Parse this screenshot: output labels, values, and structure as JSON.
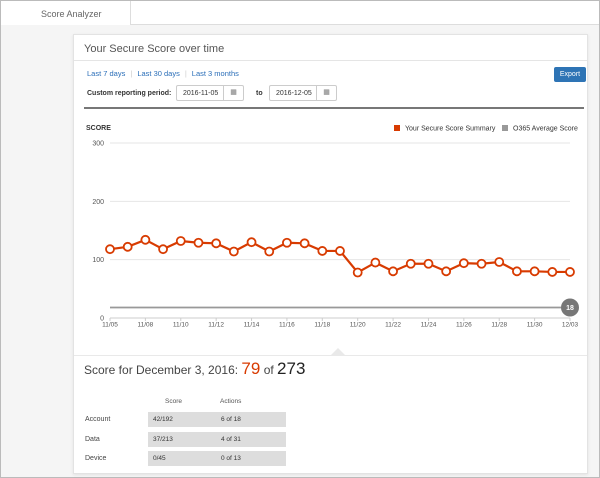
{
  "tab": {
    "label": "Score Analyzer"
  },
  "panel": {
    "title": "Your Secure Score over time",
    "range_links": [
      "Last 7 days",
      "Last 30 days",
      "Last 3 months"
    ],
    "export_label": "Export",
    "period_label": "Custom reporting period:",
    "start_date": "2016-11-05",
    "to_label": "to",
    "end_date": "2016-12-05",
    "calendar_icon": "calendar-icon"
  },
  "chart_data": {
    "type": "line",
    "ylabel": "SCORE",
    "ylim": [
      0,
      300
    ],
    "yticks": [
      0,
      100,
      200,
      300
    ],
    "x_tick_labels": [
      "11/05",
      "11/08",
      "11/10",
      "11/12",
      "11/14",
      "11/16",
      "11/18",
      "11/20",
      "11/22",
      "11/24",
      "11/26",
      "11/28",
      "11/30",
      "12/03"
    ],
    "grid": true,
    "legend_position": "top-right",
    "series": [
      {
        "name": "Your Secure Score Summary",
        "color": "#d83b01",
        "values": [
          118,
          122,
          134,
          118,
          132,
          129,
          128,
          114,
          130,
          114,
          129,
          128,
          115,
          115,
          78,
          95,
          80,
          93,
          93,
          80,
          94,
          93,
          96,
          80,
          80,
          79,
          79
        ]
      },
      {
        "name": "O365 Average Score",
        "color": "#999999",
        "values": [
          18,
          18,
          18,
          18,
          18,
          18,
          18,
          18,
          18,
          18,
          18,
          18,
          18,
          18,
          18,
          18,
          18,
          18,
          18,
          18,
          18,
          18,
          18,
          18,
          18,
          18,
          18
        ],
        "end_label": "18"
      }
    ]
  },
  "score_summary": {
    "prefix": "Score for December 3, 2016:",
    "score": "79",
    "of_label": "of",
    "max": "273"
  },
  "breakdown": {
    "headers": [
      "Score",
      "Actions"
    ],
    "rows": [
      {
        "label": "Account",
        "score": "42/192",
        "actions": "6 of 18"
      },
      {
        "label": "Data",
        "score": "37/213",
        "actions": "4 of 31"
      },
      {
        "label": "Device",
        "score": "0/45",
        "actions": "0 of 13"
      }
    ]
  }
}
